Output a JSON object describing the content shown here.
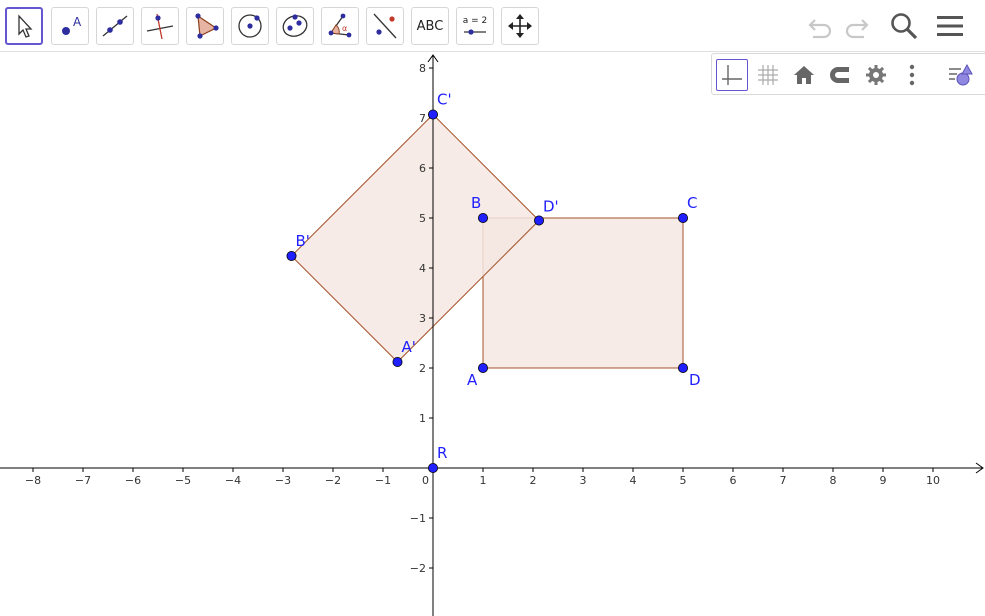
{
  "toolbar": {
    "tools": [
      {
        "name": "move-tool",
        "active": true
      },
      {
        "name": "point-tool",
        "label": "A"
      },
      {
        "name": "line-tool"
      },
      {
        "name": "perpendicular-line-tool"
      },
      {
        "name": "polygon-tool"
      },
      {
        "name": "circle-center-point-tool"
      },
      {
        "name": "conic-tool"
      },
      {
        "name": "angle-tool",
        "label": "α"
      },
      {
        "name": "reflect-tool"
      },
      {
        "name": "text-tool",
        "label": "ABC"
      },
      {
        "name": "slider-tool",
        "label": "a = 2"
      },
      {
        "name": "move-graphics-view-tool"
      }
    ],
    "right": [
      "undo-icon",
      "redo-icon",
      "search-icon",
      "menu-icon"
    ]
  },
  "style_bar": {
    "buttons": [
      "axes-toggle",
      "grid-toggle",
      "standard-view",
      "point-capturing",
      "graphics-settings",
      "more-options",
      "toggle-style-bar"
    ]
  },
  "colors": {
    "accent": "#6557d2",
    "point": "#1f1fff",
    "polygon_fill": "#f4e7e2",
    "polygon_stroke": "#a6532a",
    "axis": "#000000"
  },
  "graph": {
    "x_ticks": [
      "−8",
      "−7",
      "−6",
      "−5",
      "−4",
      "−3",
      "−2",
      "−1",
      "0",
      "1",
      "2",
      "3",
      "4",
      "5",
      "6",
      "7",
      "8",
      "9",
      "10"
    ],
    "y_ticks": [
      "−2",
      "−1",
      "1",
      "2",
      "3",
      "4",
      "5",
      "6",
      "7",
      "8"
    ],
    "points": [
      {
        "label": "A",
        "x": 1,
        "y": 2
      },
      {
        "label": "B",
        "x": 1,
        "y": 5
      },
      {
        "label": "C",
        "x": 5,
        "y": 5
      },
      {
        "label": "D",
        "x": 5,
        "y": 2
      },
      {
        "label": "A'",
        "x": -0.71,
        "y": 2.12
      },
      {
        "label": "B'",
        "x": -2.83,
        "y": 4.24
      },
      {
        "label": "C'",
        "x": 0,
        "y": 7.07
      },
      {
        "label": "D'",
        "x": 2.12,
        "y": 4.95
      },
      {
        "label": "R",
        "x": 0,
        "y": 0
      }
    ],
    "polygons": [
      {
        "name": "rectangle-ABCD",
        "vertices": [
          "A",
          "B",
          "C",
          "D"
        ]
      },
      {
        "name": "rotated-polygon",
        "vertices": [
          "A'",
          "B'",
          "C'",
          "D'"
        ]
      }
    ]
  }
}
